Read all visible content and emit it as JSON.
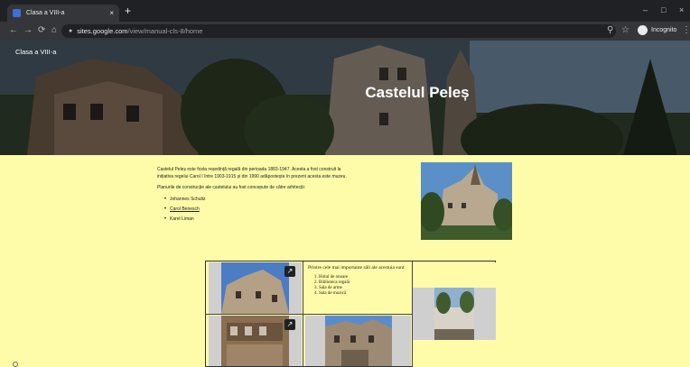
{
  "browser": {
    "tab_title": "Clasa a VIII-a",
    "tab_close": "×",
    "new_tab": "+",
    "url_host": "sites.google.com",
    "url_path": "/view/manual-cls-8/home",
    "incognito_label": "Incognito",
    "window_controls": [
      "–",
      "□",
      "×"
    ],
    "nav_glyphs": {
      "back": "←",
      "forward": "→",
      "reload": "⟳",
      "home": "⌂",
      "search": "⚲",
      "star": "☆",
      "menu": "⋮",
      "lock": "🔒"
    }
  },
  "site": {
    "name": "Clasa a VIII-a",
    "title": "Castelul Peleș",
    "intro_p1": "Castelul Peleș este fosta reședință regală din perioada 1883-1947. Acesta a fost construit la inițiativa regelui Carol I între 1903-1915 și din 1990 adăpostește în prezent acesta este muzeu.",
    "intro_p2": "Planurile de construcție ale castelului au fost concepute de către arhitecții:",
    "architects": [
      "Johannes Schultz",
      "Carol Benesch",
      "Karel Liman"
    ],
    "rooms_title": "Printre cele mai importante săli ale acestuia sunt:",
    "rooms": [
      "Holul de onoare",
      "Biblioteca regală",
      "Sala de arme",
      "Sala de muzică"
    ]
  },
  "colors": {
    "content_bg": "#fefca8",
    "chrome_dark": "#202124",
    "chrome_mid": "#35363a"
  },
  "icons": [
    "open-in-new-icon",
    "help-icon"
  ]
}
